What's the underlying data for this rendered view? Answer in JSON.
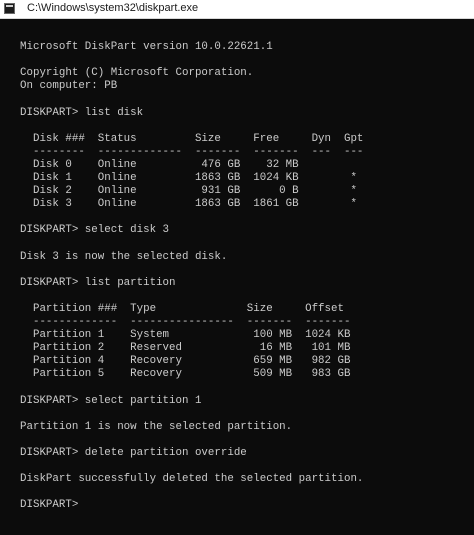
{
  "window": {
    "title": "C:\\Windows\\system32\\diskpart.exe",
    "icon": "console-icon"
  },
  "console": {
    "lines": [
      "",
      "Microsoft DiskPart version 10.0.22621.1",
      "",
      "Copyright (C) Microsoft Corporation.",
      "On computer: PB",
      "",
      "DISKPART> list disk",
      "",
      "  Disk ###  Status         Size     Free     Dyn  Gpt",
      "  --------  -------------  -------  -------  ---  ---",
      "  Disk 0    Online          476 GB    32 MB",
      "  Disk 1    Online         1863 GB  1024 KB        *",
      "  Disk 2    Online          931 GB      0 B        *",
      "  Disk 3    Online         1863 GB  1861 GB        *",
      "",
      "DISKPART> select disk 3",
      "",
      "Disk 3 is now the selected disk.",
      "",
      "DISKPART> list partition",
      "",
      "  Partition ###  Type              Size     Offset",
      "  -------------  ----------------  -------  -------",
      "  Partition 1    System             100 MB  1024 KB",
      "  Partition 2    Reserved            16 MB   101 MB",
      "  Partition 4    Recovery           659 MB   982 GB",
      "  Partition 5    Recovery           509 MB   983 GB",
      "",
      "DISKPART> select partition 1",
      "",
      "Partition 1 is now the selected partition.",
      "",
      "DISKPART> delete partition override",
      "",
      "DiskPart successfully deleted the selected partition.",
      "",
      "DISKPART> "
    ]
  },
  "colors": {
    "background": "#0c0c0c",
    "text": "#cccccc",
    "titlebar": "#ffffff"
  }
}
